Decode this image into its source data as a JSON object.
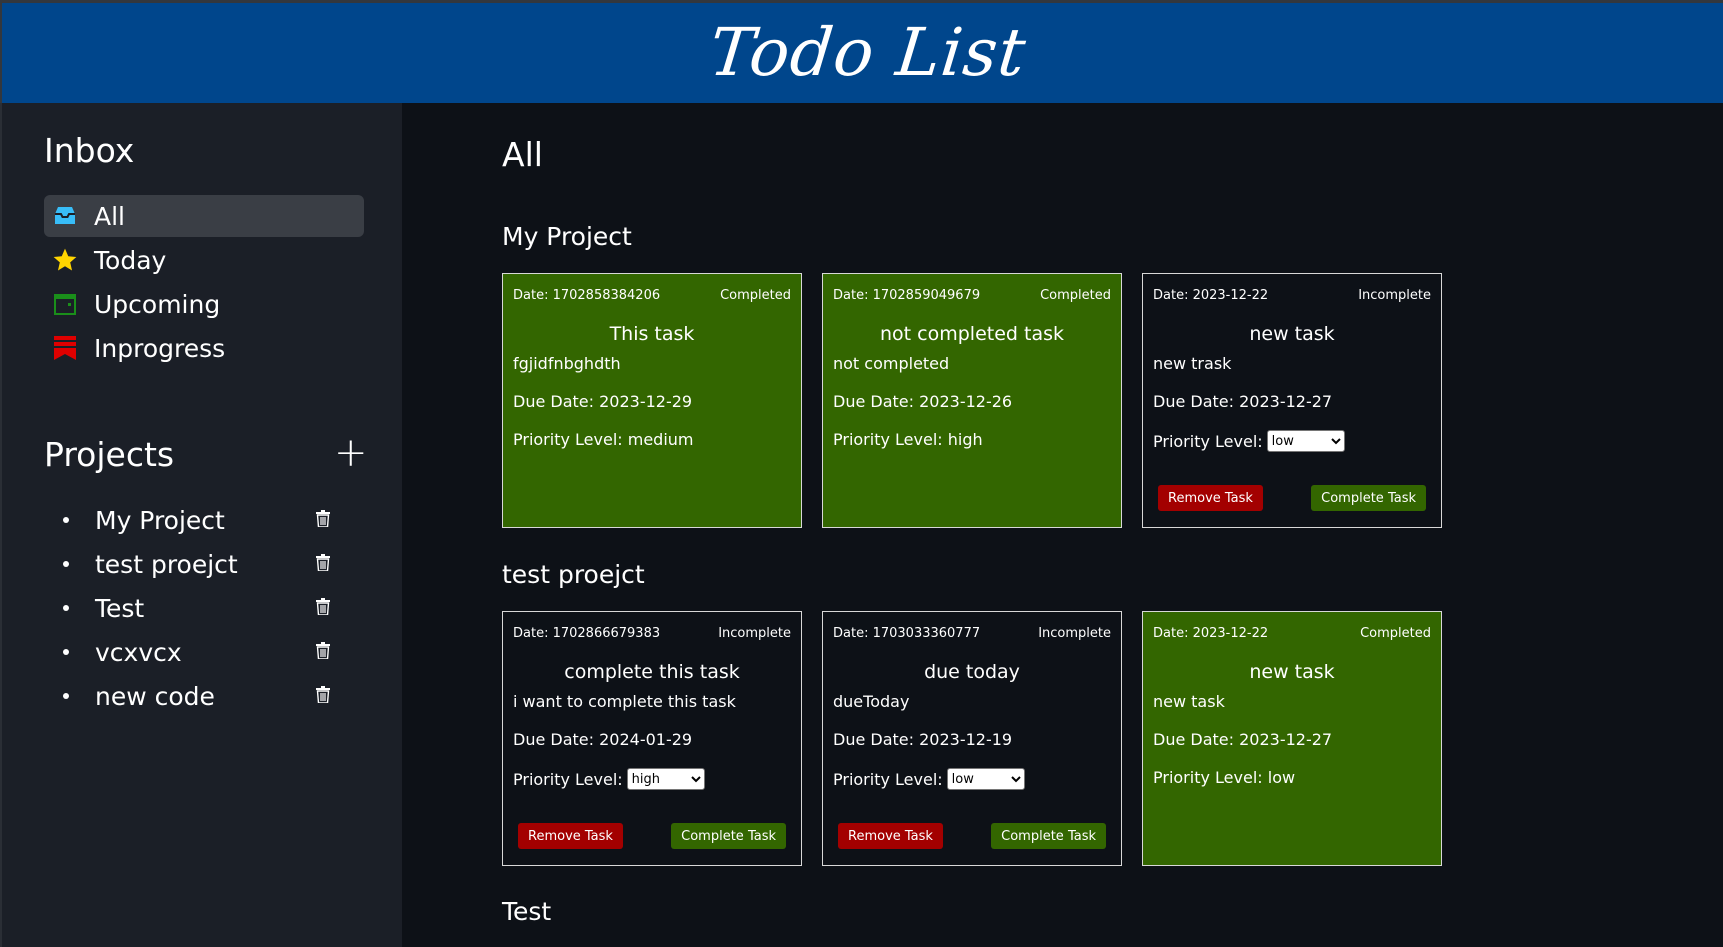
{
  "header": {
    "title": "Todo List"
  },
  "sidebar": {
    "inbox_title": "Inbox",
    "nav": [
      {
        "label": "All",
        "icon": "inbox-icon",
        "color": "#38bdf8",
        "active": true
      },
      {
        "label": "Today",
        "icon": "star-icon",
        "color": "#ffd400",
        "active": false
      },
      {
        "label": "Upcoming",
        "icon": "calendar-icon",
        "color": "#1a8f1a",
        "active": false
      },
      {
        "label": "Inprogress",
        "icon": "bookmark-icon",
        "color": "#e00000",
        "active": false
      }
    ],
    "projects_title": "Projects",
    "add_project": "+",
    "projects": [
      {
        "name": "My Project"
      },
      {
        "name": "test proejct"
      },
      {
        "name": "Test"
      },
      {
        "name": "vcxvcx"
      },
      {
        "name": "new code"
      }
    ]
  },
  "main": {
    "title": "All",
    "sections": [
      {
        "name": "My Project",
        "cards": [
          {
            "date": "Date: 1702858384206",
            "status": "Completed",
            "title": "This task",
            "desc": "fgjidfnbghdth",
            "due": "Due Date: 2023-12-29",
            "priority_label": "Priority Level:",
            "priority_text": "Priority Level: medium",
            "priority": "medium",
            "completed": true
          },
          {
            "date": "Date: 1702859049679",
            "status": "Completed",
            "title": "not completed task",
            "desc": "not completed",
            "due": "Due Date: 2023-12-26",
            "priority_label": "Priority Level:",
            "priority_text": "Priority Level: high",
            "priority": "high",
            "completed": true
          },
          {
            "date": "Date: 2023-12-22",
            "status": "Incomplete",
            "title": "new task",
            "desc": "new trask",
            "due": "Due Date: 2023-12-27",
            "priority_label": "Priority Level:",
            "priority": "low",
            "completed": false,
            "remove_label": "Remove Task",
            "complete_label": "Complete Task"
          }
        ]
      },
      {
        "name": "test proejct",
        "cards": [
          {
            "date": "Date: 1702866679383",
            "status": "Incomplete",
            "title": "complete this task",
            "desc": "i want to complete this task",
            "due": "Due Date: 2024-01-29",
            "priority_label": "Priority Level:",
            "priority": "high",
            "completed": false,
            "remove_label": "Remove Task",
            "complete_label": "Complete Task"
          },
          {
            "date": "Date: 1703033360777",
            "status": "Incomplete",
            "title": "due today",
            "desc": "dueToday",
            "due": "Due Date: 2023-12-19",
            "priority_label": "Priority Level:",
            "priority": "low",
            "completed": false,
            "remove_label": "Remove Task",
            "complete_label": "Complete Task"
          },
          {
            "date": "Date: 2023-12-22",
            "status": "Completed",
            "title": "new task",
            "desc": "new task",
            "due": "Due Date: 2023-12-27",
            "priority_label": "Priority Level:",
            "priority_text": "Priority Level: low",
            "priority": "low",
            "completed": true
          }
        ]
      },
      {
        "name": "Test",
        "cards": []
      }
    ],
    "priority_options": [
      "low",
      "medium",
      "high"
    ]
  },
  "colors": {
    "header": "#00468c",
    "sidebar": "#1b1f27",
    "background": "#0d1117",
    "completed_card": "#336600",
    "remove_button": "#a30000",
    "complete_button": "#336600"
  }
}
